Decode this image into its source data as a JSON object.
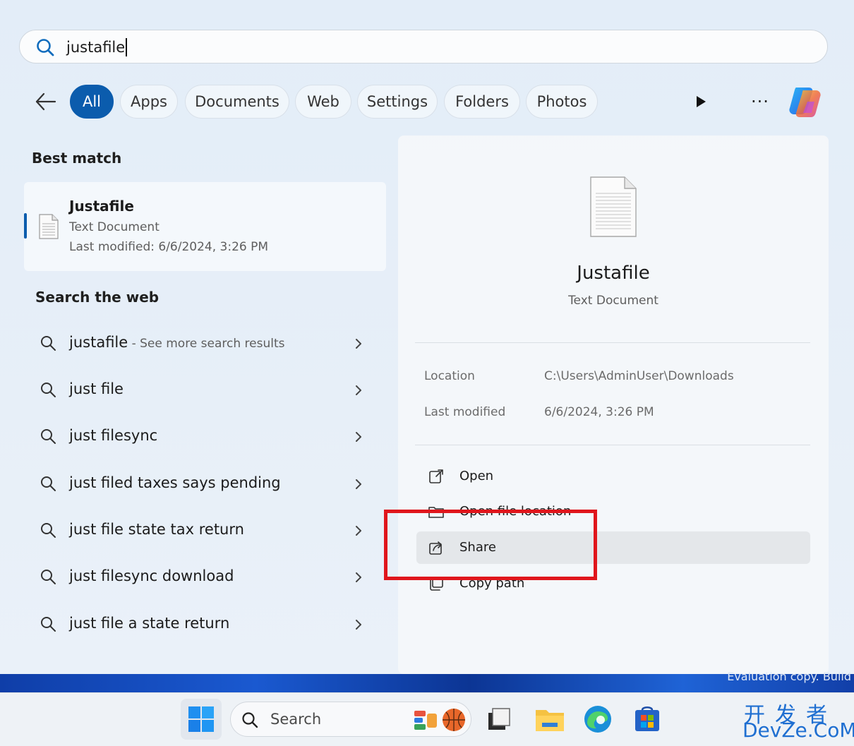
{
  "search": {
    "query": "justafile"
  },
  "filters": {
    "tabs": [
      {
        "label": "All",
        "active": true
      },
      {
        "label": "Apps"
      },
      {
        "label": "Documents"
      },
      {
        "label": "Web"
      },
      {
        "label": "Settings"
      },
      {
        "label": "Folders"
      },
      {
        "label": "Photos"
      }
    ],
    "more_label": "···"
  },
  "best_match": {
    "section_title": "Best match",
    "name": "Justafile",
    "type": "Text Document",
    "modified": "Last modified: 6/6/2024, 3:26 PM"
  },
  "web": {
    "section_title": "Search the web",
    "items": [
      {
        "label": "justafile",
        "hint": " - See more search results"
      },
      {
        "label": "just file"
      },
      {
        "label": "just filesync"
      },
      {
        "label": "just filed taxes says pending"
      },
      {
        "label": "just file state tax return"
      },
      {
        "label": "just filesync download"
      },
      {
        "label": "just file a state return"
      }
    ]
  },
  "preview": {
    "title": "Justafile",
    "subtitle": "Text Document",
    "location_label": "Location",
    "location_value": "C:\\Users\\AdminUser\\Downloads",
    "modified_label": "Last modified",
    "modified_value": "6/6/2024, 3:26 PM",
    "actions": [
      {
        "label": "Open",
        "icon": "open-external-icon"
      },
      {
        "label": "Open file location",
        "icon": "folder-icon"
      },
      {
        "label": "Share",
        "icon": "share-icon"
      },
      {
        "label": "Copy path",
        "icon": "copy-icon"
      }
    ]
  },
  "taskbar": {
    "search_label": "Search"
  },
  "overlay": {
    "eval_text": "Evaluation copy. Build"
  },
  "watermark": {
    "line1": "开发者",
    "line2": "DevZe.CoM"
  },
  "colors": {
    "accent": "#0b5cad",
    "highlight_box": "#e0161c"
  }
}
